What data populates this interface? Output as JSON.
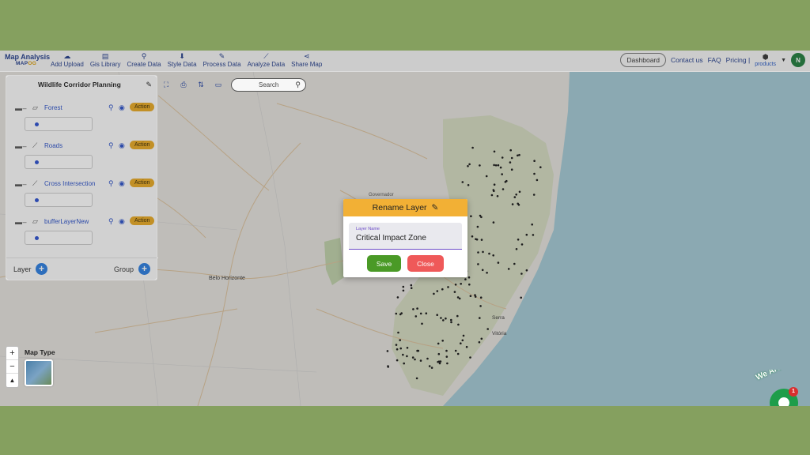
{
  "app": {
    "logo_title": "Map Analysis",
    "logo_sub_a": "MAP",
    "logo_sub_b": "OG"
  },
  "nav": [
    {
      "icon": "☁",
      "label": "Add Upload"
    },
    {
      "icon": "▤",
      "label": "Gis Library"
    },
    {
      "icon": "⚲",
      "label": "Create Data"
    },
    {
      "icon": "⬇",
      "label": "Style Data"
    },
    {
      "icon": "✎",
      "label": "Process Data"
    },
    {
      "icon": "⟋",
      "label": "Analyze Data"
    },
    {
      "icon": "⋖",
      "label": "Share Map"
    }
  ],
  "header_right": {
    "dashboard": "Dashboard",
    "contact": "Contact us",
    "faq": "FAQ",
    "pricing": "Pricing |",
    "products": "products",
    "avatar": "N"
  },
  "panel": {
    "title": "Wildlife Corridor Planning",
    "layers": [
      {
        "name": "Forest",
        "type_icon": "⏥",
        "action": "Action"
      },
      {
        "name": "Roads",
        "type_icon": "⟋",
        "action": "Action"
      },
      {
        "name": "Cross Intersection",
        "type_icon": "⟋",
        "action": "Action"
      },
      {
        "name": "bufferLayerNew",
        "type_icon": "⏥",
        "action": "Action"
      }
    ],
    "layer_label": "Layer",
    "group_label": "Group"
  },
  "map_tools": {
    "search_placeholder": "Search"
  },
  "map_type": {
    "label": "Map Type"
  },
  "map_labels": {
    "belo_horizonte": "Belo Horizonte",
    "vitoria": "Vitória",
    "serra": "Serra",
    "governador": "Governador"
  },
  "dialog": {
    "title": "Rename Layer",
    "field_label": "Layer Name",
    "field_value": "Critical Impact Zone",
    "save": "Save",
    "close": "Close"
  },
  "chat": {
    "text": "We Are Here!",
    "badge": "1"
  },
  "colors": {
    "accent_blue": "#2a50c8",
    "action_orange": "#e8a820",
    "dialog_header": "#f2b035",
    "save_green": "#4a9a26",
    "close_red": "#ef5959",
    "frame_green": "#85a05f"
  }
}
